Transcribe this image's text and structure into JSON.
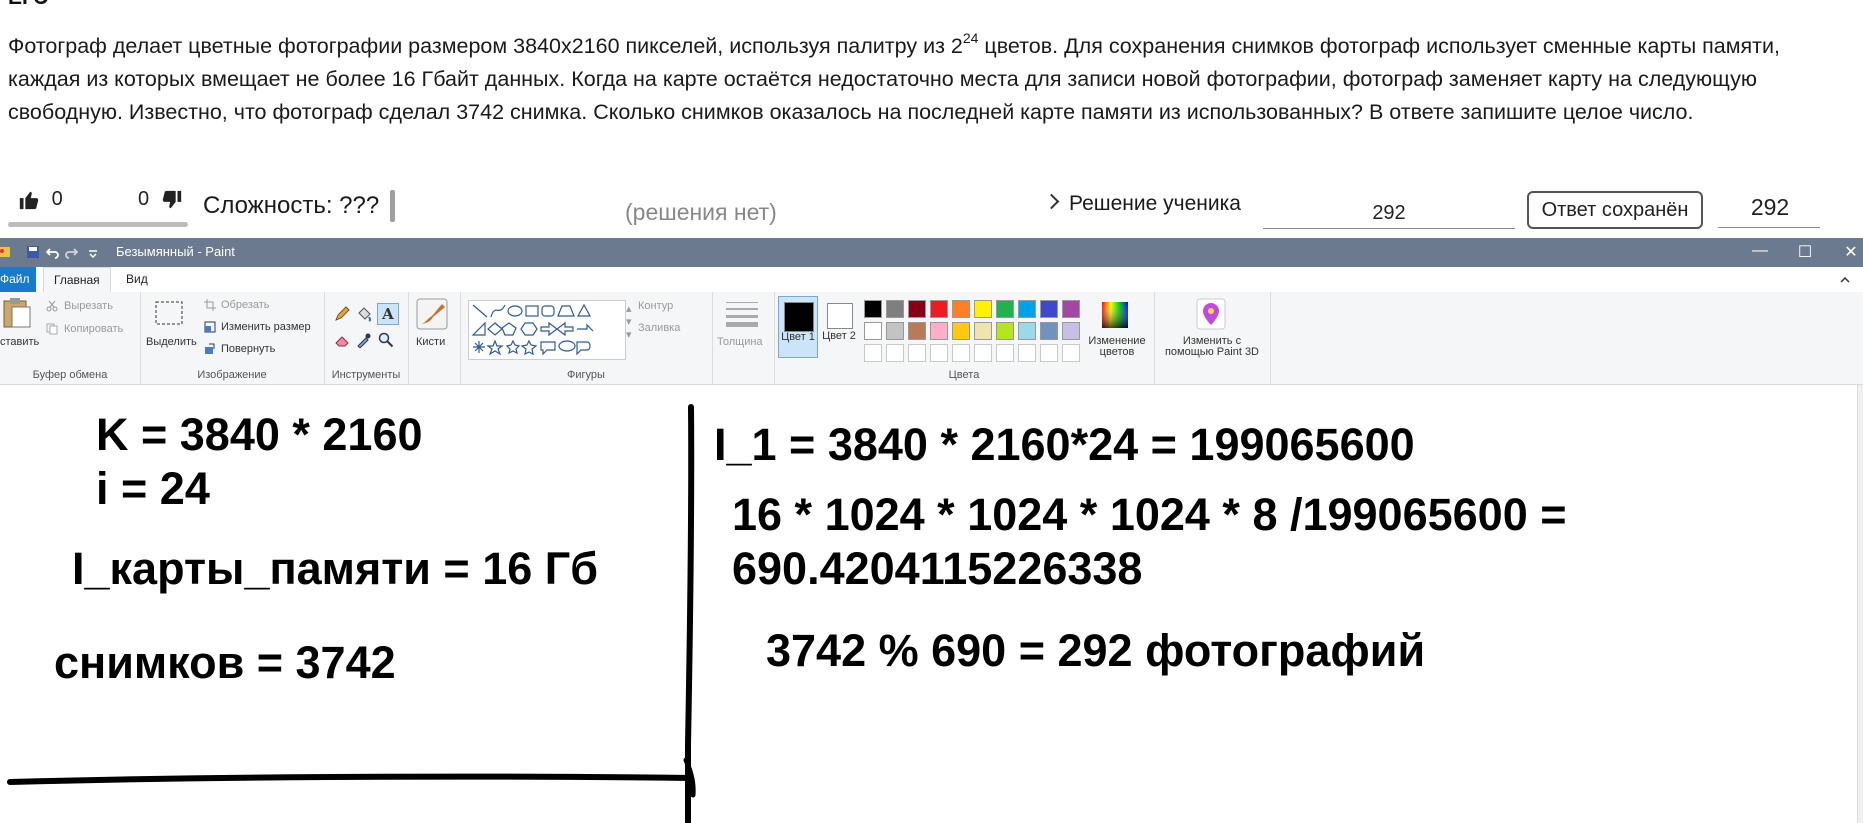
{
  "page": {
    "header": "ЕГЭ",
    "task_part1": "Фотограф делает цветные фотографии размером 3840x2160 пикселей, используя палитру из 2",
    "task_sup": "24",
    "task_part2": " цветов. Для сохранения снимков фотограф использует сменные карты памяти, каждая из которых вмещает не более 16 Гбайт данных. Когда на карте остаётся недостаточно места для записи новой фотографии, фотограф заменяет карту на следующую свободную. Известно, что фотограф сделал 3742 снимка. Сколько снимков оказалось на последней карте памяти из использованных? В ответе запишите целое число.",
    "likes": "0",
    "dislikes": "0",
    "difficulty": "Сложность: ???",
    "no_solution": "(решения нет)",
    "student_solution": "Решение ученика",
    "answer_input": "292",
    "saved_button": "Ответ сохранён",
    "answer_value": "292"
  },
  "paint": {
    "title": "Безымянный - Paint",
    "tabs": [
      "Файл",
      "Главная",
      "Вид"
    ],
    "clipboard": {
      "paste": "ставить",
      "cut": "Вырезать",
      "copy": "Копировать",
      "label": "Буфер обмена"
    },
    "image": {
      "select": "Выделить",
      "crop": "Обрезать",
      "resize": "Изменить размер",
      "rotate": "Повернуть",
      "label": "Изображение"
    },
    "tools": {
      "label": "Инструменты"
    },
    "brushes": "Кисти",
    "shapes": {
      "outline": "Контур",
      "fill": "Заливка",
      "label": "Фигуры"
    },
    "thickness": "Толщина",
    "color1": "Цвет 1",
    "color2": "Цвет 2",
    "colors_label": "Цвета",
    "edit_colors": "Изменение цветов",
    "paint3d": "Изменить с помощью Paint 3D",
    "palette_row1": [
      "#000000",
      "#7f7f7f",
      "#880015",
      "#ed1c24",
      "#ff7f27",
      "#fff200",
      "#22b14c",
      "#00a2e8",
      "#3f48cc",
      "#a349a4"
    ],
    "palette_row2": [
      "#ffffff",
      "#c3c3c3",
      "#b97a57",
      "#ffaec9",
      "#ffc90e",
      "#efe4b0",
      "#b5e61d",
      "#99d9ea",
      "#7092be",
      "#c8bfe7"
    ]
  },
  "canvas_text": {
    "k": "K = 3840 * 2160",
    "i": "i = 24",
    "card": "I_карты_памяти = 16 Гб",
    "shots": "снимков = 3742",
    "i1": "I_1 = 3840 * 2160*24 = 199065600",
    "calc1": "16 * 1024 * 1024 * 1024 * 8 /199065600 =",
    "calc2": "690.4204115226338",
    "result": "3742 % 690 = 292 фотографий"
  }
}
